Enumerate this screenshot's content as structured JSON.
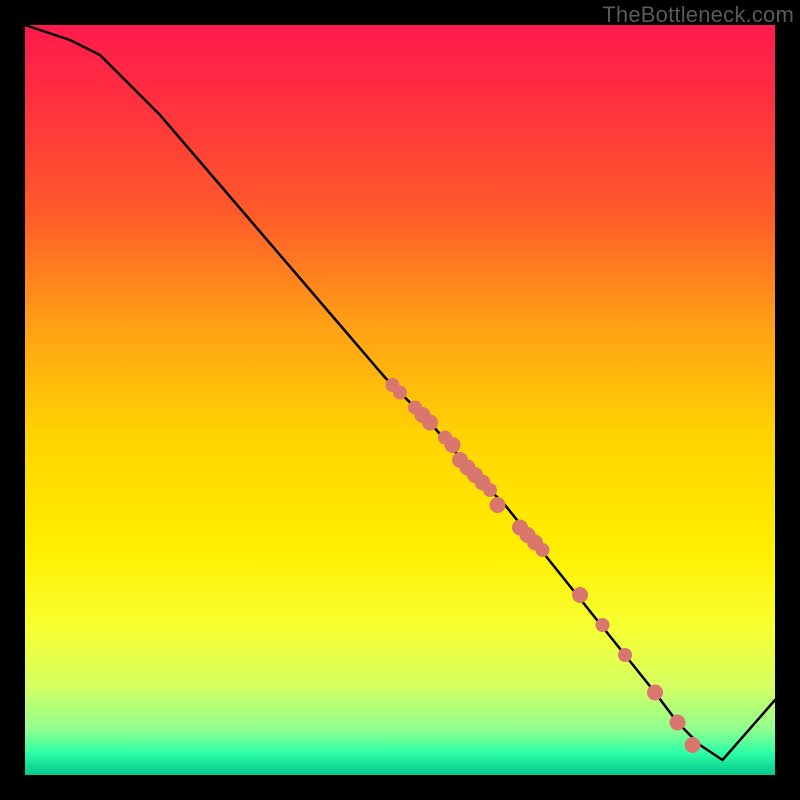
{
  "watermark": "TheBottleneck.com",
  "colors": {
    "curve_stroke": "#000000",
    "marker_fill": "#d9776e",
    "marker_stroke": "#c86058"
  },
  "chart_data": {
    "type": "line",
    "title": "",
    "xlabel": "",
    "ylabel": "",
    "xlim": [
      0,
      100
    ],
    "ylim": [
      0,
      100
    ],
    "series": [
      {
        "name": "bottleneck-curve",
        "x": [
          0,
          6,
          10,
          14,
          18,
          24,
          30,
          36,
          42,
          48,
          54,
          60,
          64,
          68,
          72,
          76,
          80,
          84,
          87,
          90,
          93,
          100
        ],
        "y": [
          100,
          98,
          96,
          92,
          88,
          81,
          74,
          67,
          60,
          53,
          47,
          40,
          36,
          31,
          26,
          21,
          16,
          11,
          7,
          4,
          2,
          10
        ]
      }
    ],
    "markers": {
      "name": "data-points",
      "x": [
        49,
        50,
        52,
        53,
        54,
        56,
        57,
        58,
        59,
        60,
        61,
        62,
        63,
        66,
        67,
        68,
        69,
        74,
        77,
        80,
        84,
        87,
        89
      ],
      "y": [
        52,
        51,
        49,
        48,
        47,
        45,
        44,
        42,
        41,
        40,
        39,
        38,
        36,
        33,
        32,
        31,
        30,
        24,
        20,
        16,
        11,
        7,
        4
      ],
      "r": [
        7,
        7,
        7,
        8,
        8,
        7,
        8,
        8,
        8,
        8,
        8,
        7,
        8,
        8,
        8,
        8,
        7,
        8,
        7,
        7,
        8,
        8,
        8
      ]
    }
  }
}
